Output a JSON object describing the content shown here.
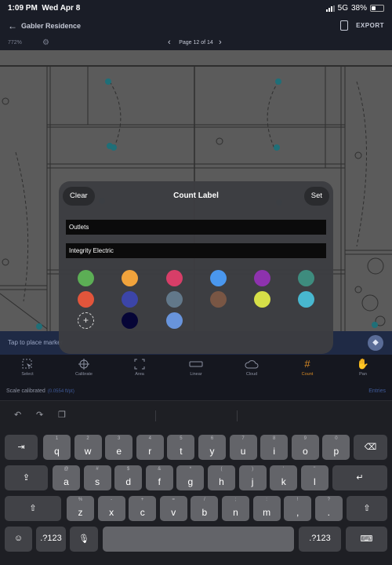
{
  "status": {
    "time": "1:09 PM",
    "date": "Wed Apr 8",
    "network": "5G",
    "battery": "38%"
  },
  "nav": {
    "back_icon": "arrow-left-icon",
    "title": "Gabler Residence",
    "clipboard_icon": "clipboard-icon",
    "export_label": "EXPORT"
  },
  "pagebar": {
    "zoom": "772%",
    "page_label": "Page 12 of 14",
    "prev": "‹",
    "next": "›"
  },
  "hint": "Tap to place marker",
  "modal": {
    "title": "Count Label",
    "clear_label": "Clear",
    "set_label": "Set",
    "label_value": "Outlets",
    "company_value": "Integrity Electric",
    "colors": [
      "#5cae55",
      "#f1a33c",
      "#d73e68",
      "#4a97ee",
      "#8e32ae",
      "#3e8c7e",
      "#e2553b",
      "#3c45a8",
      "#62788a",
      "#795644",
      "#d6df48",
      "#48b7cf",
      "#060536",
      "#6894dc"
    ],
    "add_color_icon": "plus-icon"
  },
  "toolbar": {
    "items": [
      {
        "label": "Select",
        "icon": "select-icon"
      },
      {
        "label": "Calibrate",
        "icon": "crosshair-icon"
      },
      {
        "label": "Area",
        "icon": "area-icon"
      },
      {
        "label": "Linear",
        "icon": "linear-icon"
      },
      {
        "label": "Cloud",
        "icon": "cloud-icon"
      },
      {
        "label": "Count",
        "icon": "hash-icon"
      },
      {
        "label": "Pan",
        "icon": "hand-icon"
      }
    ],
    "active": "Count",
    "accent": "#d98b25"
  },
  "scale": {
    "label": "Scale calibrated",
    "value": "(0.0554 ft/pt)",
    "entries": "Entries"
  },
  "keyboard": {
    "toolbar_icons": [
      "undo-icon",
      "redo-icon",
      "paste-icon"
    ],
    "row1": [
      {
        "sub": "1",
        "main": "q"
      },
      {
        "sub": "2",
        "main": "w"
      },
      {
        "sub": "3",
        "main": "e"
      },
      {
        "sub": "4",
        "main": "r"
      },
      {
        "sub": "5",
        "main": "t"
      },
      {
        "sub": "6",
        "main": "y"
      },
      {
        "sub": "7",
        "main": "u"
      },
      {
        "sub": "8",
        "main": "i"
      },
      {
        "sub": "9",
        "main": "o"
      },
      {
        "sub": "0",
        "main": "p"
      }
    ],
    "row2": [
      {
        "sub": "@",
        "main": "a"
      },
      {
        "sub": "#",
        "main": "s"
      },
      {
        "sub": "$",
        "main": "d"
      },
      {
        "sub": "&",
        "main": "f"
      },
      {
        "sub": "*",
        "main": "g"
      },
      {
        "sub": "(",
        "main": "h"
      },
      {
        "sub": ")",
        "main": "j"
      },
      {
        "sub": "'",
        "main": "k"
      },
      {
        "sub": "\"",
        "main": "l"
      }
    ],
    "row3": [
      {
        "sub": "%",
        "main": "z"
      },
      {
        "sub": "-",
        "main": "x"
      },
      {
        "sub": "+",
        "main": "c"
      },
      {
        "sub": "=",
        "main": "v"
      },
      {
        "sub": "/",
        "main": "b"
      },
      {
        "sub": ";",
        "main": "n"
      },
      {
        "sub": ":",
        "main": "m"
      },
      {
        "sub": "!",
        "main": ","
      },
      {
        "sub": "?",
        "main": "."
      }
    ],
    "num_label": ".?123",
    "tab_icon": "tab-icon",
    "delete_icon": "delete-icon",
    "return_icon": "return-icon",
    "shift_icon": "shift-icon",
    "emoji_icon": "emoji-icon",
    "mic_icon": "mic-icon",
    "hide_icon": "keyboard-hide-icon"
  }
}
